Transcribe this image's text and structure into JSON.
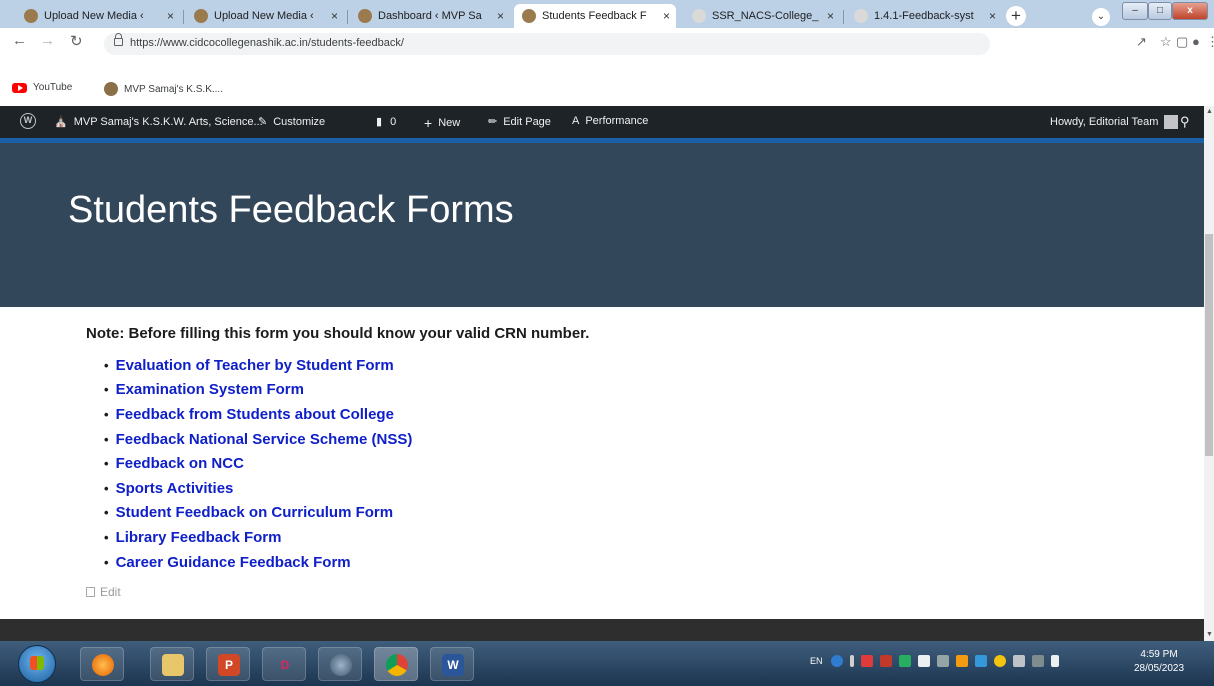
{
  "browser": {
    "tabs": [
      {
        "title": "Upload New Media ‹",
        "active": false
      },
      {
        "title": "Upload New Media ‹",
        "active": false
      },
      {
        "title": "Dashboard ‹ MVP Sa",
        "active": false
      },
      {
        "title": "Students Feedback F",
        "active": true
      },
      {
        "title": "SSR_NACS-College_",
        "active": false
      },
      {
        "title": "1.4.1-Feedback-syst",
        "active": false
      }
    ],
    "tab_close_glyph": "×",
    "new_tab_glyph": "+",
    "url": "https://www.cidcocollegenashik.ac.in/students-feedback/",
    "bookmarks": [
      "YouTube",
      "MVP Samaj's K.S.K...."
    ]
  },
  "wp_admin_bar": {
    "site_name": "MVP Samaj's K.S.K.W. Arts, Science...",
    "customize": "Customize",
    "comments_count": "0",
    "new": "New",
    "edit_page": "Edit Page",
    "performance": "Performance",
    "greeting": "Howdy, Editorial Team"
  },
  "page": {
    "title": "Students Feedback Forms",
    "note": "Note: Before filling this form you should know your valid CRN number.",
    "links": [
      "Evaluation of Teacher by Student Form",
      "Examination System Form",
      "Feedback from Students about College",
      "Feedback National Service Scheme (NSS)",
      "Feedback on NCC",
      "Sports Activities",
      "Student Feedback on Curriculum Form",
      "Library Feedback Form",
      "Career Guidance Feedback Form"
    ],
    "edit_label": "Edit"
  },
  "taskbar": {
    "language": "EN",
    "time": "4:59 PM",
    "date": "28/05/2023"
  },
  "colors": {
    "hero_bg": "#33475b",
    "link": "#1020c8",
    "admin_bar": "#1d2327",
    "accent_stripe": "#1b5fa8"
  }
}
